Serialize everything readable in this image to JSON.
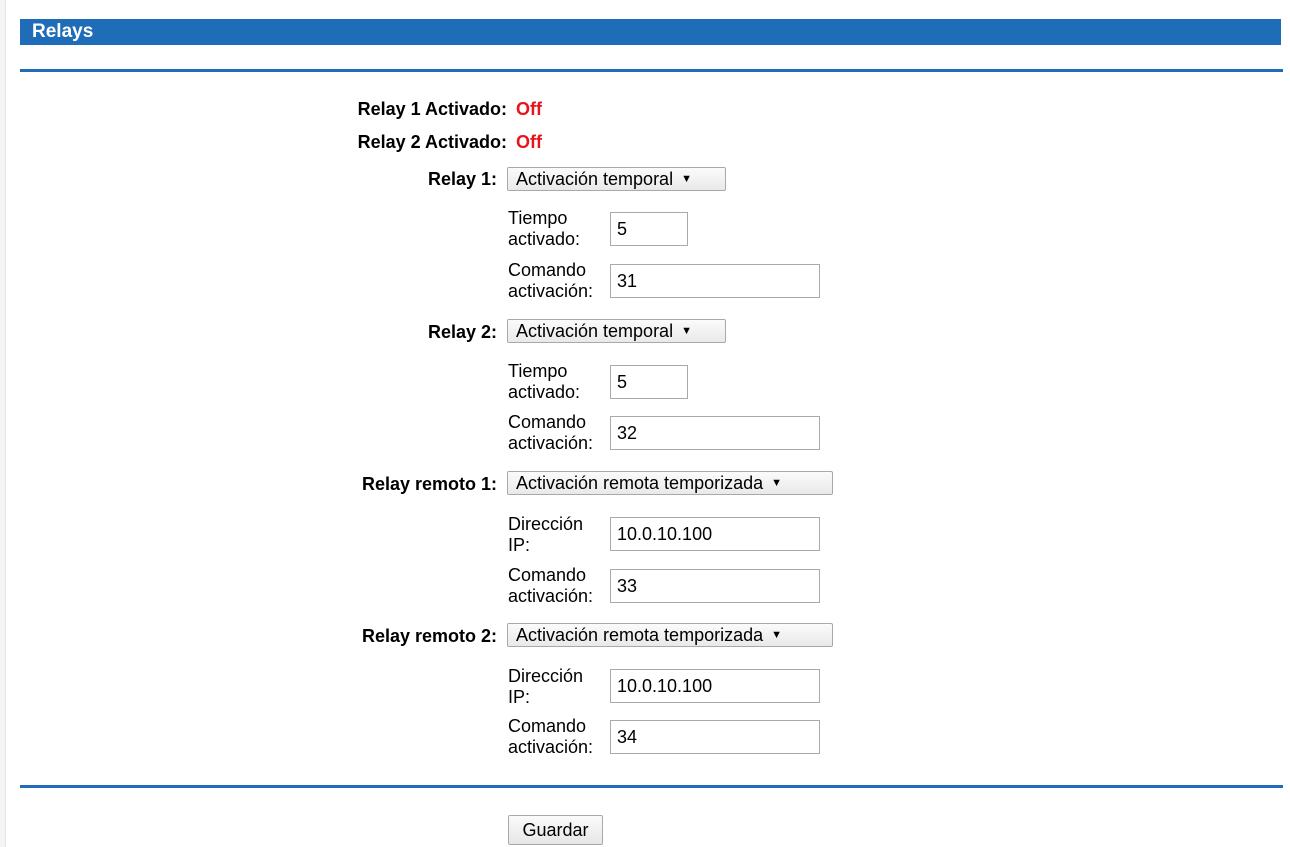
{
  "section": {
    "title": "Relays"
  },
  "status": [
    {
      "label": "Relay 1 Activado:",
      "value": "Off"
    },
    {
      "label": "Relay 2 Activado:",
      "value": "Off"
    }
  ],
  "relays": [
    {
      "label": "Relay 1:",
      "mode": "Activación temporal",
      "fields": [
        {
          "label_line1": "Tiempo",
          "label_line2": "activado:",
          "value": "5"
        },
        {
          "label_line1": "Comando",
          "label_line2": "activación:",
          "value": "31"
        }
      ]
    },
    {
      "label": "Relay 2:",
      "mode": "Activación temporal",
      "fields": [
        {
          "label_line1": "Tiempo",
          "label_line2": "activado:",
          "value": "5"
        },
        {
          "label_line1": "Comando",
          "label_line2": "activación:",
          "value": "32"
        }
      ]
    },
    {
      "label": "Relay remoto 1:",
      "mode": "Activación remota temporizada",
      "fields": [
        {
          "label_line1": "Dirección",
          "label_line2": "IP:",
          "value": "10.0.10.100"
        },
        {
          "label_line1": "Comando",
          "label_line2": "activación:",
          "value": "33"
        }
      ]
    },
    {
      "label": "Relay remoto 2:",
      "mode": "Activación remota temporizada",
      "fields": [
        {
          "label_line1": "Dirección",
          "label_line2": "IP:",
          "value": "10.0.10.100"
        },
        {
          "label_line1": "Comando",
          "label_line2": "activación:",
          "value": "34"
        }
      ]
    }
  ],
  "actions": {
    "save_label": "Guardar"
  },
  "colors": {
    "header_blue": "#1f6db8",
    "status_red": "#e8141c"
  },
  "icons": {
    "dropdown": "dropdown-triangle-icon"
  }
}
